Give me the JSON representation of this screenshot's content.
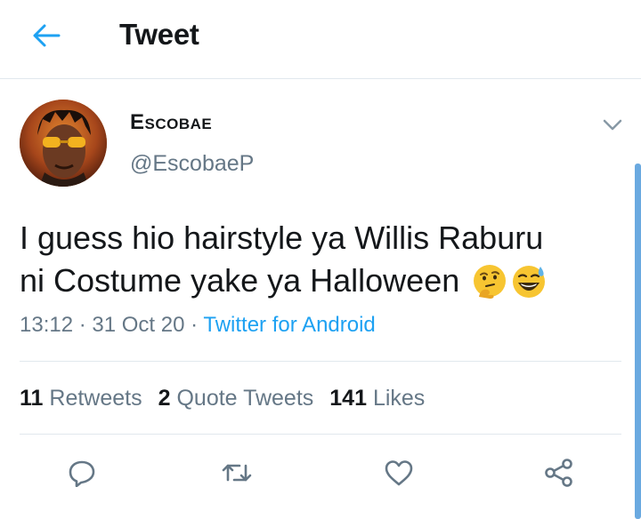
{
  "header": {
    "title": "Tweet"
  },
  "tweet": {
    "display_name": "Escobae",
    "handle": "@EscobaeP",
    "text_line1": "I guess hio hairstyle ya Willis Raburu",
    "text_line2": "ni Costume yake ya  Halloween",
    "time": "13:12",
    "separator": " · ",
    "date": "31 Oct 20",
    "source": "Twitter for Android"
  },
  "stats": {
    "retweets_count": "11",
    "retweets_label": "Retweets",
    "quotes_count": "2",
    "quotes_label": "Quote Tweets",
    "likes_count": "141",
    "likes_label": "Likes"
  },
  "icons": {
    "back": "arrow-left-icon",
    "caret": "chevron-down-icon",
    "reply": "reply-icon",
    "retweet": "retweet-icon",
    "like": "heart-icon",
    "share": "share-icon",
    "emoji1": "thinking-face-emoji",
    "emoji2": "grinning-sweat-emoji"
  },
  "colors": {
    "accent": "#1da1f2",
    "muted": "#657786",
    "text": "#14171a",
    "divider": "#e1e8ed"
  }
}
